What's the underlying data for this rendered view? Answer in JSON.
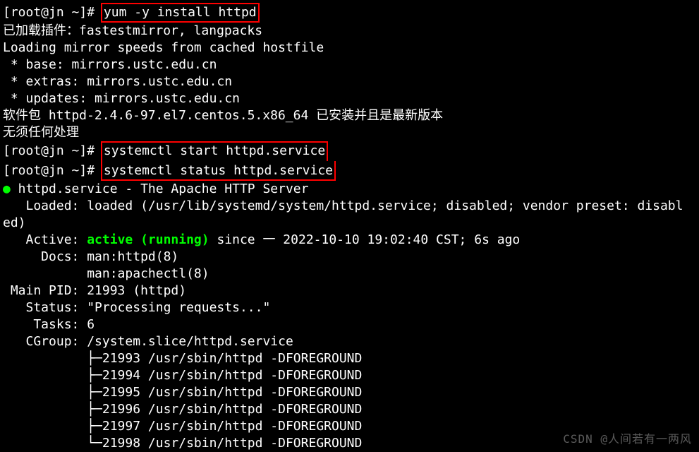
{
  "prompt": "[root@jn ~]# ",
  "cmd1": "yum -y install httpd",
  "out1a": "已加载插件：fastestmirror, langpacks",
  "out1b": "Loading mirror speeds from cached hostfile",
  "out1c": " * base: mirrors.ustc.edu.cn",
  "out1d": " * extras: mirrors.ustc.edu.cn",
  "out1e": " * updates: mirrors.ustc.edu.cn",
  "out1f": "软件包 httpd-2.4.6-97.el7.centos.5.x86_64 已安装并且是最新版本",
  "out1g": "无须任何处理",
  "cmd2": "systemctl start httpd.service",
  "cmd3": "systemctl status httpd.service",
  "status": {
    "bullet": "●",
    "title": " httpd.service - The Apache HTTP Server",
    "loaded": "   Loaded: loaded (/usr/lib/systemd/system/httpd.service; disabled; vendor preset: disabl\ned)",
    "active_label": "   Active: ",
    "active_state": "active (running)",
    "active_rest": " since 一 2022-10-10 19:02:40 CST; 6s ago",
    "docs1": "     Docs: man:httpd(8)",
    "docs2": "           man:apachectl(8)",
    "mainpid": " Main PID: 21993 (httpd)",
    "statusline": "   Status: \"Processing requests...\"",
    "tasks": "    Tasks: 6",
    "cgroup": "   CGroup: /system.slice/httpd.service",
    "procs": [
      "           ├─21993 /usr/sbin/httpd -DFOREGROUND",
      "           ├─21994 /usr/sbin/httpd -DFOREGROUND",
      "           ├─21995 /usr/sbin/httpd -DFOREGROUND",
      "           ├─21996 /usr/sbin/httpd -DFOREGROUND",
      "           ├─21997 /usr/sbin/httpd -DFOREGROUND",
      "           └─21998 /usr/sbin/httpd -DFOREGROUND"
    ]
  },
  "watermark": "CSDN @人间若有一两风"
}
